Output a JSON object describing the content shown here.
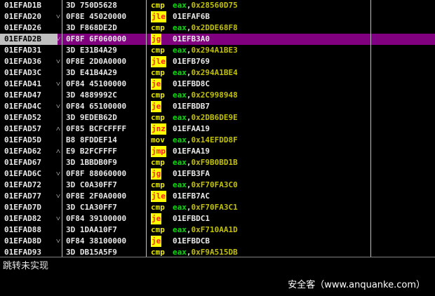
{
  "rows": [
    {
      "addr": "01EFAD1B",
      "arrow": "",
      "hex": "3D 750D5628",
      "mn": "cmp",
      "kind": "cmp",
      "reg": "eax",
      "imm": "0x28560D75",
      "tgt": ""
    },
    {
      "addr": "01EFAD20",
      "arrow": "˅",
      "hex": "0F8E 45020000",
      "mn": "jle",
      "kind": "jcc",
      "reg": "",
      "imm": "",
      "tgt": "01EFAF6B"
    },
    {
      "addr": "01EFAD26",
      "arrow": "",
      "hex": "3D F868DE2D",
      "mn": "cmp",
      "kind": "cmp",
      "reg": "eax",
      "imm": "0x2DDE68F8",
      "tgt": ""
    },
    {
      "addr": "01EFAD2B",
      "arrow": "˅",
      "hex": "0F8F 6F060000",
      "mn": "jg",
      "kind": "jcc",
      "reg": "",
      "imm": "",
      "tgt": "01EFB3A0",
      "selected": true
    },
    {
      "addr": "01EFAD31",
      "arrow": "",
      "hex": "3D E31B4A29",
      "mn": "cmp",
      "kind": "cmp",
      "reg": "eax",
      "imm": "0x294A1BE3",
      "tgt": ""
    },
    {
      "addr": "01EFAD36",
      "arrow": "˅",
      "hex": "0F8E 2D0A0000",
      "mn": "jle",
      "kind": "jcc",
      "reg": "",
      "imm": "",
      "tgt": "01EFB769"
    },
    {
      "addr": "01EFAD3C",
      "arrow": "",
      "hex": "3D E41B4A29",
      "mn": "cmp",
      "kind": "cmp",
      "reg": "eax",
      "imm": "0x294A1BE4",
      "tgt": ""
    },
    {
      "addr": "01EFAD41",
      "arrow": "˅",
      "hex": "0F84 45100000",
      "mn": "je",
      "kind": "jcc",
      "reg": "",
      "imm": "",
      "tgt": "01EFBD8C"
    },
    {
      "addr": "01EFAD47",
      "arrow": "",
      "hex": "3D 4889992C",
      "mn": "cmp",
      "kind": "cmp",
      "reg": "eax",
      "imm": "0x2C998948",
      "tgt": ""
    },
    {
      "addr": "01EFAD4C",
      "arrow": "˅",
      "hex": "0F84 65100000",
      "mn": "je",
      "kind": "jcc",
      "reg": "",
      "imm": "",
      "tgt": "01EFBDB7"
    },
    {
      "addr": "01EFAD52",
      "arrow": "",
      "hex": "3D 9EDEB62D",
      "mn": "cmp",
      "kind": "cmp",
      "reg": "eax",
      "imm": "0x2DB6DE9E",
      "tgt": ""
    },
    {
      "addr": "01EFAD57",
      "arrow": "˄",
      "hex": "0F85 BCFCFFFF",
      "mn": "jnz",
      "kind": "jcc",
      "reg": "",
      "imm": "",
      "tgt": "01EFAA19"
    },
    {
      "addr": "01EFAD5D",
      "arrow": "",
      "hex": "B8 8FDDEF14",
      "mn": "mov",
      "kind": "mov",
      "reg": "eax",
      "imm": "0x14EFDD8F",
      "tgt": ""
    },
    {
      "addr": "01EFAD62",
      "arrow": "˄",
      "hex": "E9 B2FCFFFF",
      "mn": "jmp",
      "kind": "jmp",
      "reg": "",
      "imm": "",
      "tgt": "01EFAA19"
    },
    {
      "addr": "01EFAD67",
      "arrow": "",
      "hex": "3D 1BBDB0F9",
      "mn": "cmp",
      "kind": "cmp",
      "reg": "eax",
      "imm": "0xF9B0BD1B",
      "tgt": ""
    },
    {
      "addr": "01EFAD6C",
      "arrow": "˅",
      "hex": "0F8F 88060000",
      "mn": "jg",
      "kind": "jcc",
      "reg": "",
      "imm": "",
      "tgt": "01EFB3FA"
    },
    {
      "addr": "01EFAD72",
      "arrow": "",
      "hex": "3D C0A30FF7",
      "mn": "cmp",
      "kind": "cmp",
      "reg": "eax",
      "imm": "0xF70FA3C0",
      "tgt": ""
    },
    {
      "addr": "01EFAD77",
      "arrow": "˅",
      "hex": "0F8E 2F0A0000",
      "mn": "jle",
      "kind": "jcc",
      "reg": "",
      "imm": "",
      "tgt": "01EFB7AC"
    },
    {
      "addr": "01EFAD7D",
      "arrow": "",
      "hex": "3D C1A30FF7",
      "mn": "cmp",
      "kind": "cmp",
      "reg": "eax",
      "imm": "0xF70FA3C1",
      "tgt": ""
    },
    {
      "addr": "01EFAD82",
      "arrow": "˅",
      "hex": "0F84 39100000",
      "mn": "je",
      "kind": "jcc",
      "reg": "",
      "imm": "",
      "tgt": "01EFBDC1"
    },
    {
      "addr": "01EFAD88",
      "arrow": "",
      "hex": "3D 1DAA10F7",
      "mn": "cmp",
      "kind": "cmp",
      "reg": "eax",
      "imm": "0xF710AA1D",
      "tgt": ""
    },
    {
      "addr": "01EFAD8D",
      "arrow": "˅",
      "hex": "0F84 38100000",
      "mn": "je",
      "kind": "jcc",
      "reg": "",
      "imm": "",
      "tgt": "01EFBDCB"
    },
    {
      "addr": "01EFAD93",
      "arrow": "",
      "hex": "3D DB15A5F9",
      "mn": "cmp",
      "kind": "cmp",
      "reg": "eax",
      "imm": "0xF9A515DB",
      "tgt": ""
    }
  ],
  "status": {
    "text": "跳转未实现"
  },
  "watermark": {
    "text": "安全客（www.anquanke.com）"
  }
}
